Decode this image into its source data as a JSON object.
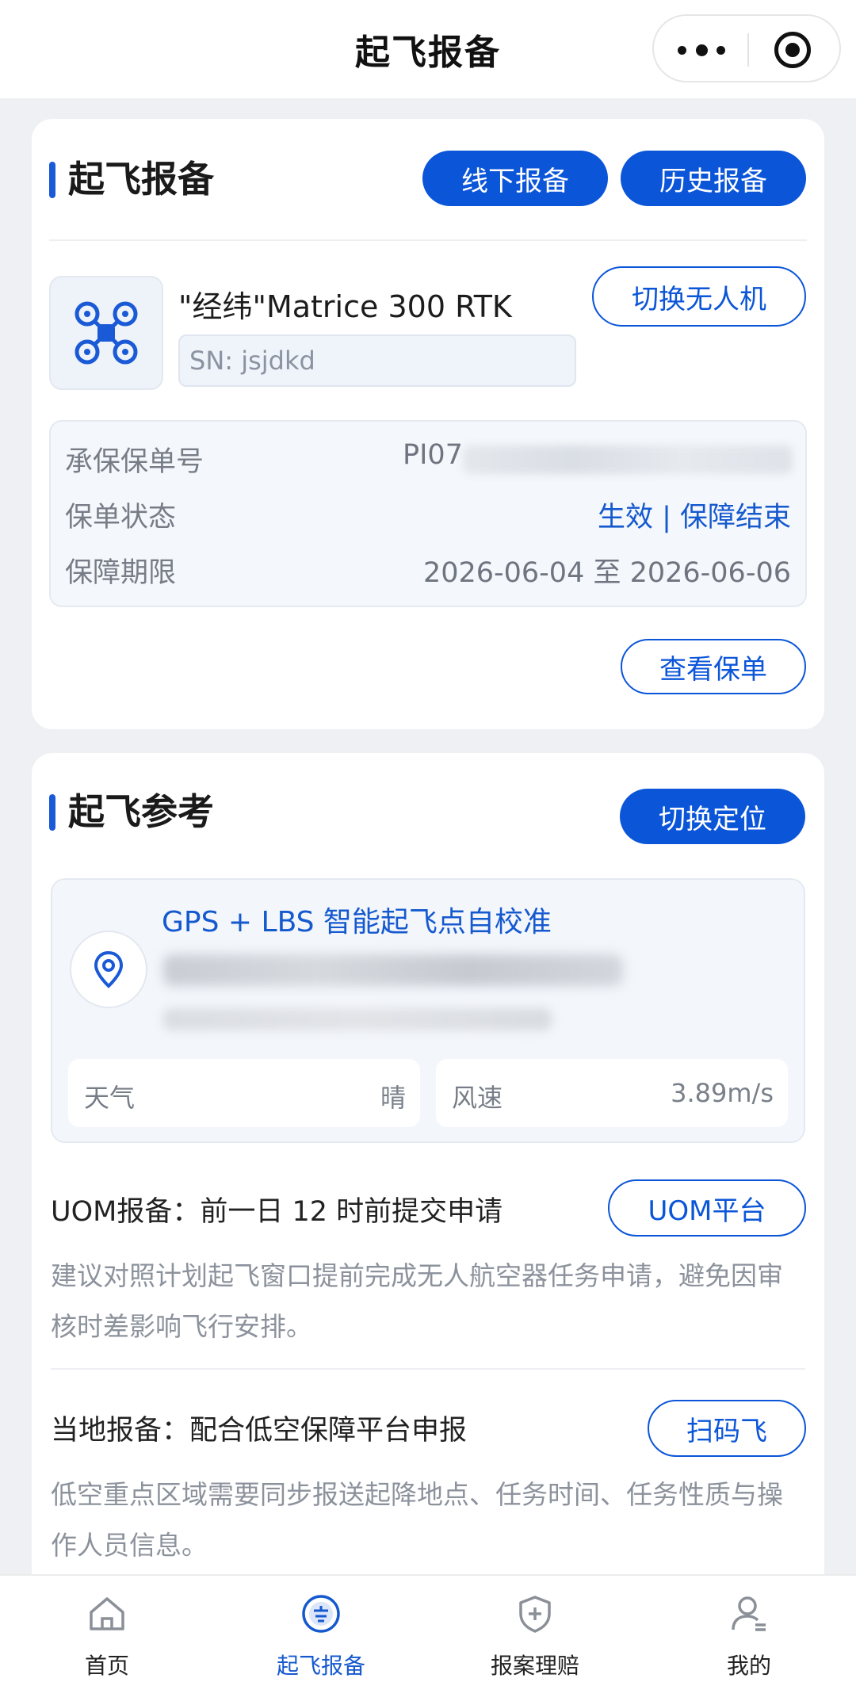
{
  "navbar": {
    "title": "起飞报备",
    "more_icon": "more-dots-icon",
    "close_icon": "target-circle-icon"
  },
  "filing_card": {
    "title": "起飞报备",
    "offline_btn": "线下报备",
    "history_btn": "历史报备",
    "drone": {
      "icon": "drone-icon",
      "name": "\"经纬\"Matrice 300 RTK",
      "sn": "SN: jsjdkd",
      "switch_btn": "切换无人机"
    },
    "policy": {
      "no_label": "承保保单号",
      "no_value": "PI07",
      "status_label": "保单状态",
      "status_value": "生效 | 保障结束",
      "period_label": "保障期限",
      "period_value": "2026-06-04 至 2026-06-06"
    },
    "view_policy_btn": "查看保单"
  },
  "reference_card": {
    "title": "起飞参考",
    "switch_location_btn": "切换定位",
    "location": {
      "icon": "location-pin-icon",
      "title": "GPS + LBS 智能起飞点自校准"
    },
    "weather": {
      "weather_label": "天气",
      "weather_value": "晴",
      "wind_label": "风速",
      "wind_value": "3.89m/s"
    },
    "uom": {
      "title": "UOM报备：前一日 12 时前提交申请",
      "button": "UOM平台",
      "desc": "建议对照计划起飞窗口提前完成无人航空器任务申请，避免因审核时差影响飞行安排。"
    },
    "local": {
      "title": "当地报备：配合低空保障平台申报",
      "button": "扫码飞",
      "desc": "低空重点区域需要同步报送起降地点、任务时间、任务性质与操作人员信息。"
    }
  },
  "tabbar": {
    "items": [
      {
        "label": "首页",
        "icon": "home-icon"
      },
      {
        "label": "起飞报备",
        "icon": "filing-icon"
      },
      {
        "label": "报案理赔",
        "icon": "shield-plus-icon"
      },
      {
        "label": "我的",
        "icon": "user-icon"
      }
    ],
    "active_index": 1,
    "active_color": "#1559cf"
  },
  "colors": {
    "primary": "#0b55d9",
    "accent_text": "#1559cf",
    "background": "#eef0f3"
  }
}
